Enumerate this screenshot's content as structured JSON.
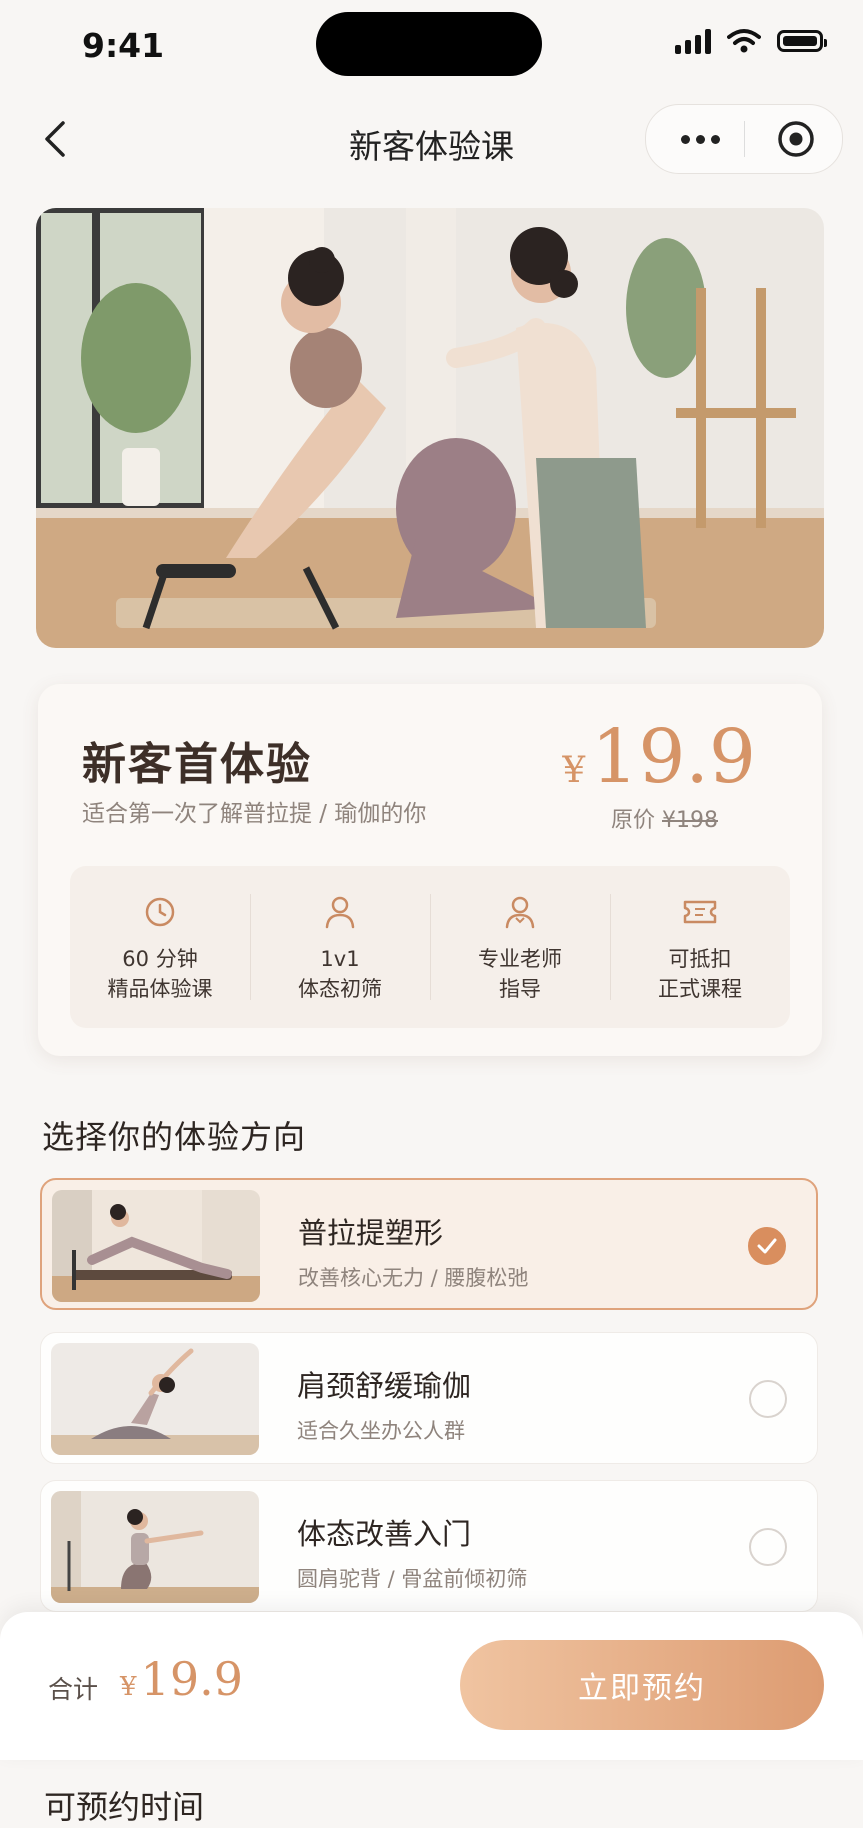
{
  "status_bar": {
    "time": "9:41"
  },
  "nav": {
    "title": "新客体验课"
  },
  "offer": {
    "title": "新客首体验",
    "subtitle": "适合第一次了解普拉提 / 瑜伽的你",
    "currency": "¥",
    "price": "19.9",
    "original_label": "原价",
    "original_price": "¥198",
    "features": [
      {
        "icon": "clock-icon",
        "line1": "60 分钟",
        "line2": "精品体验课"
      },
      {
        "icon": "user-icon",
        "line1": "1v1",
        "line2": "体态初筛"
      },
      {
        "icon": "teacher-icon",
        "line1": "专业老师",
        "line2": "指导"
      },
      {
        "icon": "ticket-icon",
        "line1": "可抵扣",
        "line2": "正式课程"
      }
    ]
  },
  "section": {
    "title": "选择你的体验方向"
  },
  "options": [
    {
      "name": "普拉提塑形",
      "desc": "改善核心无力 / 腰腹松弛",
      "selected": true
    },
    {
      "name": "肩颈舒缓瑜伽",
      "desc": "适合久坐办公人群",
      "selected": false
    },
    {
      "name": "体态改善入门",
      "desc": "圆肩驼背 / 骨盆前倾初筛",
      "selected": false
    }
  ],
  "footer": {
    "total_label": "合计",
    "currency": "¥",
    "total_price": "19.9",
    "book_label": "立即预约"
  },
  "slots": {
    "title": "可预约时间"
  },
  "colors": {
    "accent": "#d69467",
    "button_start": "#f0c4a1",
    "button_end": "#dd9c72",
    "selected_bg": "#f9efe7"
  }
}
